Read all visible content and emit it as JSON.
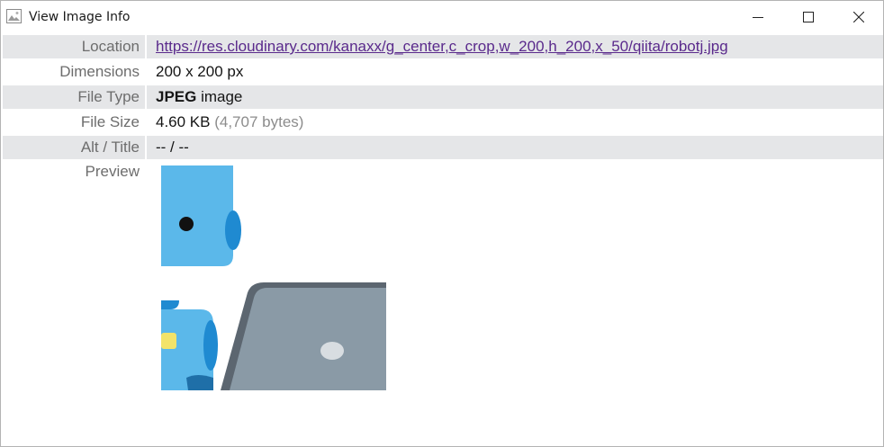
{
  "window": {
    "title": "View Image Info",
    "icons": [
      "image-icon",
      "minimize-icon",
      "maximize-icon",
      "close-icon"
    ]
  },
  "rows": {
    "location": {
      "label": "Location",
      "value": "https://res.cloudinary.com/kanaxx/g_center,c_crop,w_200,h_200,x_50/qiita/robotj.jpg"
    },
    "dimensions": {
      "label": "Dimensions",
      "value": "200 x 200 px"
    },
    "file_type": {
      "label": "File Type",
      "value_bold": "JPEG",
      "value_rest": " image"
    },
    "file_size": {
      "label": "File Size",
      "value": "4.60 KB",
      "value_extra": " (4,707 bytes)"
    },
    "alt_title": {
      "label": "Alt / Title",
      "value": "-- / --"
    },
    "preview": {
      "label": "Preview"
    }
  },
  "colors": {
    "row_shade": "#e5e6e8",
    "label_text": "#6d6d6d",
    "link": "#5a2a8c",
    "robot_blue": "#5bb8ea",
    "robot_dark_blue": "#1f8ad1",
    "laptop_gray": "#8a9aa6",
    "laptop_dark": "#5c6670"
  }
}
